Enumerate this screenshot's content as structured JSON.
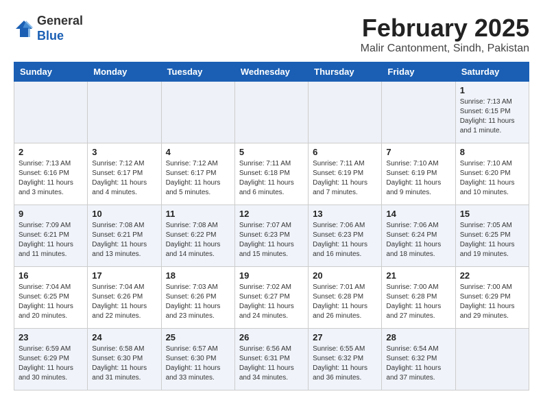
{
  "header": {
    "logo_line1": "General",
    "logo_line2": "Blue",
    "title": "February 2025",
    "subtitle": "Malir Cantonment, Sindh, Pakistan"
  },
  "weekdays": [
    "Sunday",
    "Monday",
    "Tuesday",
    "Wednesday",
    "Thursday",
    "Friday",
    "Saturday"
  ],
  "weeks": [
    [
      {
        "day": "",
        "info": ""
      },
      {
        "day": "",
        "info": ""
      },
      {
        "day": "",
        "info": ""
      },
      {
        "day": "",
        "info": ""
      },
      {
        "day": "",
        "info": ""
      },
      {
        "day": "",
        "info": ""
      },
      {
        "day": "1",
        "info": "Sunrise: 7:13 AM\nSunset: 6:15 PM\nDaylight: 11 hours\nand 1 minute."
      }
    ],
    [
      {
        "day": "2",
        "info": "Sunrise: 7:13 AM\nSunset: 6:16 PM\nDaylight: 11 hours\nand 3 minutes."
      },
      {
        "day": "3",
        "info": "Sunrise: 7:12 AM\nSunset: 6:17 PM\nDaylight: 11 hours\nand 4 minutes."
      },
      {
        "day": "4",
        "info": "Sunrise: 7:12 AM\nSunset: 6:17 PM\nDaylight: 11 hours\nand 5 minutes."
      },
      {
        "day": "5",
        "info": "Sunrise: 7:11 AM\nSunset: 6:18 PM\nDaylight: 11 hours\nand 6 minutes."
      },
      {
        "day": "6",
        "info": "Sunrise: 7:11 AM\nSunset: 6:19 PM\nDaylight: 11 hours\nand 7 minutes."
      },
      {
        "day": "7",
        "info": "Sunrise: 7:10 AM\nSunset: 6:19 PM\nDaylight: 11 hours\nand 9 minutes."
      },
      {
        "day": "8",
        "info": "Sunrise: 7:10 AM\nSunset: 6:20 PM\nDaylight: 11 hours\nand 10 minutes."
      }
    ],
    [
      {
        "day": "9",
        "info": "Sunrise: 7:09 AM\nSunset: 6:21 PM\nDaylight: 11 hours\nand 11 minutes."
      },
      {
        "day": "10",
        "info": "Sunrise: 7:08 AM\nSunset: 6:21 PM\nDaylight: 11 hours\nand 13 minutes."
      },
      {
        "day": "11",
        "info": "Sunrise: 7:08 AM\nSunset: 6:22 PM\nDaylight: 11 hours\nand 14 minutes."
      },
      {
        "day": "12",
        "info": "Sunrise: 7:07 AM\nSunset: 6:23 PM\nDaylight: 11 hours\nand 15 minutes."
      },
      {
        "day": "13",
        "info": "Sunrise: 7:06 AM\nSunset: 6:23 PM\nDaylight: 11 hours\nand 16 minutes."
      },
      {
        "day": "14",
        "info": "Sunrise: 7:06 AM\nSunset: 6:24 PM\nDaylight: 11 hours\nand 18 minutes."
      },
      {
        "day": "15",
        "info": "Sunrise: 7:05 AM\nSunset: 6:25 PM\nDaylight: 11 hours\nand 19 minutes."
      }
    ],
    [
      {
        "day": "16",
        "info": "Sunrise: 7:04 AM\nSunset: 6:25 PM\nDaylight: 11 hours\nand 20 minutes."
      },
      {
        "day": "17",
        "info": "Sunrise: 7:04 AM\nSunset: 6:26 PM\nDaylight: 11 hours\nand 22 minutes."
      },
      {
        "day": "18",
        "info": "Sunrise: 7:03 AM\nSunset: 6:26 PM\nDaylight: 11 hours\nand 23 minutes."
      },
      {
        "day": "19",
        "info": "Sunrise: 7:02 AM\nSunset: 6:27 PM\nDaylight: 11 hours\nand 24 minutes."
      },
      {
        "day": "20",
        "info": "Sunrise: 7:01 AM\nSunset: 6:28 PM\nDaylight: 11 hours\nand 26 minutes."
      },
      {
        "day": "21",
        "info": "Sunrise: 7:00 AM\nSunset: 6:28 PM\nDaylight: 11 hours\nand 27 minutes."
      },
      {
        "day": "22",
        "info": "Sunrise: 7:00 AM\nSunset: 6:29 PM\nDaylight: 11 hours\nand 29 minutes."
      }
    ],
    [
      {
        "day": "23",
        "info": "Sunrise: 6:59 AM\nSunset: 6:29 PM\nDaylight: 11 hours\nand 30 minutes."
      },
      {
        "day": "24",
        "info": "Sunrise: 6:58 AM\nSunset: 6:30 PM\nDaylight: 11 hours\nand 31 minutes."
      },
      {
        "day": "25",
        "info": "Sunrise: 6:57 AM\nSunset: 6:30 PM\nDaylight: 11 hours\nand 33 minutes."
      },
      {
        "day": "26",
        "info": "Sunrise: 6:56 AM\nSunset: 6:31 PM\nDaylight: 11 hours\nand 34 minutes."
      },
      {
        "day": "27",
        "info": "Sunrise: 6:55 AM\nSunset: 6:32 PM\nDaylight: 11 hours\nand 36 minutes."
      },
      {
        "day": "28",
        "info": "Sunrise: 6:54 AM\nSunset: 6:32 PM\nDaylight: 11 hours\nand 37 minutes."
      },
      {
        "day": "",
        "info": ""
      }
    ]
  ]
}
